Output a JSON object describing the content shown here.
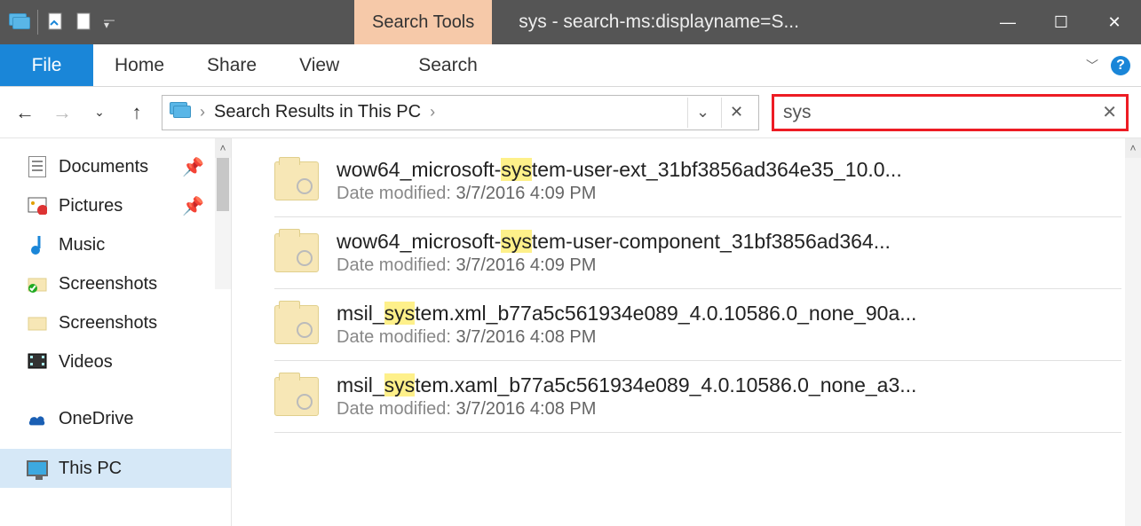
{
  "titlebar": {
    "context_tab": "Search Tools",
    "title": "sys - search-ms:displayname=S..."
  },
  "ribbon": {
    "file": "File",
    "tabs": [
      "Home",
      "Share",
      "View"
    ],
    "context_tab": "Search"
  },
  "address": {
    "path": "Search Results in This PC"
  },
  "search": {
    "value": "sys"
  },
  "sidebar": {
    "items": [
      {
        "label": "Documents",
        "icon": "document-icon",
        "pinned": true
      },
      {
        "label": "Pictures",
        "icon": "pictures-icon",
        "pinned": true
      },
      {
        "label": "Music",
        "icon": "music-icon"
      },
      {
        "label": "Screenshots",
        "icon": "folder-check-icon"
      },
      {
        "label": "Screenshots",
        "icon": "folder-icon"
      },
      {
        "label": "Videos",
        "icon": "videos-icon"
      }
    ],
    "lower": [
      {
        "label": "OneDrive",
        "icon": "onedrive-icon"
      },
      {
        "label": "This PC",
        "icon": "this-pc-icon",
        "selected": true
      }
    ]
  },
  "results": [
    {
      "pre": "wow64_microsoft-",
      "hl": "sys",
      "post": "tem-user-ext_31bf3856ad364e35_10.0...",
      "date_label": "Date modified:",
      "date": "3/7/2016 4:09 PM"
    },
    {
      "pre": "wow64_microsoft-",
      "hl": "sys",
      "post": "tem-user-component_31bf3856ad364...",
      "date_label": "Date modified:",
      "date": "3/7/2016 4:09 PM"
    },
    {
      "pre": "msil_",
      "hl": "sys",
      "post": "tem.xml_b77a5c561934e089_4.0.10586.0_none_90a...",
      "date_label": "Date modified:",
      "date": "3/7/2016 4:08 PM"
    },
    {
      "pre": "msil_",
      "hl": "sys",
      "post": "tem.xaml_b77a5c561934e089_4.0.10586.0_none_a3...",
      "date_label": "Date modified:",
      "date": "3/7/2016 4:08 PM"
    }
  ]
}
